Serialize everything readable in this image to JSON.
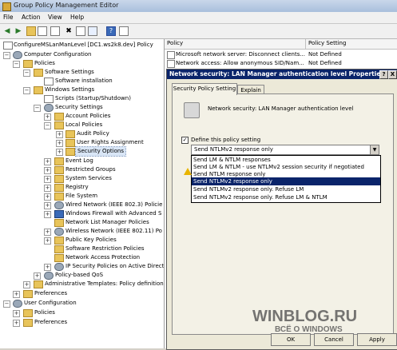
{
  "window": {
    "title": "Group Policy Management Editor"
  },
  "menu": [
    "File",
    "Action",
    "View",
    "Help"
  ],
  "tree": {
    "root": "ConfigureMSLanManLevel [DC1.ws2k8.dev] Policy",
    "items": [
      "Computer Configuration",
      "Policies",
      "Software Settings",
      "Software installation",
      "Windows Settings",
      "Scripts (Startup/Shutdown)",
      "Security Settings",
      "Account Policies",
      "Local Policies",
      "Audit Policy",
      "User Rights Assignment",
      "Security Options",
      "Event Log",
      "Restricted Groups",
      "System Services",
      "Registry",
      "File System",
      "Wired Network (IEEE 802.3) Policie",
      "Windows Firewall with Advanced S",
      "Network List Manager Policies",
      "Wireless Network (IEEE 802.11) Po",
      "Public Key Policies",
      "Software Restriction Policies",
      "Network Access Protection",
      "IP Security Policies on Active Direct",
      "Policy-based QoS",
      "Administrative Templates: Policy definitions",
      "Preferences",
      "User Configuration",
      "Policies",
      "Preferences"
    ]
  },
  "list": {
    "columns": [
      "Policy",
      "Policy Setting"
    ],
    "rows": [
      {
        "policy": "Microsoft network server: Disconnect clients...",
        "setting": "Not Defined"
      },
      {
        "policy": "Network access: Allow anonymous SID/Nam...",
        "setting": "Not Defined"
      }
    ]
  },
  "dialog": {
    "title": "Network security: LAN Manager authentication level Properties",
    "help_btn": "?",
    "close_btn": "X",
    "tabs": [
      "Security Policy Setting",
      "Explain"
    ],
    "policy_name": "Network security: LAN Manager authentication level",
    "checkbox_label": "Define this policy setting",
    "checkbox_checked": true,
    "selected_value": "Send NTLMv2 response only",
    "options": [
      "Send LM & NTLM responses",
      "Send LM & NTLM - use NTLMv2 session security if negotiated",
      "Send NTLM response only",
      "Send NTLMv2 response only",
      "Send NTLMv2 response only. Refuse LM",
      "Send NTLMv2 response only. Refuse LM & NTLM"
    ],
    "highlighted_option_index": 3,
    "buttons": [
      "OK",
      "Cancel",
      "Apply"
    ]
  },
  "watermark": {
    "line1": "WINBLOG.RU",
    "line2": "ВСЁ О WINDOWS"
  },
  "colors": {
    "dialog_title_bg": "#0a246a",
    "selection": "#0a246a",
    "warning": "#e8b400"
  }
}
